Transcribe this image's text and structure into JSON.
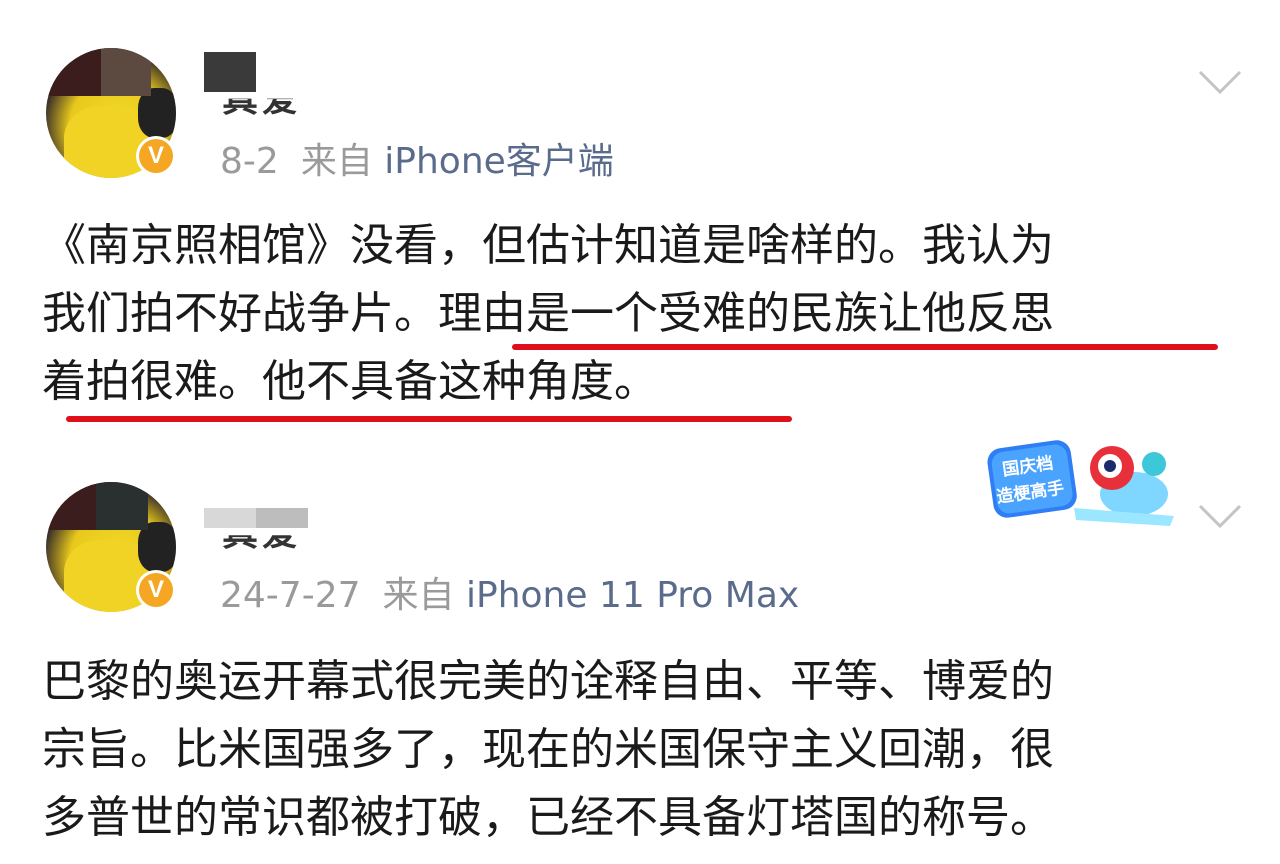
{
  "posts": [
    {
      "author_name": "真爱",
      "date": "8-2",
      "source_prefix": "来自",
      "device": "iPhone客户端",
      "verified_badge": "V",
      "lines": [
        "《南京照相馆》没看，但估计知道是啥样的。我认为",
        "我们拍不好战争片。理由是一个受难的民族让他反思",
        "着拍很难。他不具备这种角度。"
      ]
    },
    {
      "author_name": "真爱",
      "date": "24-7-27",
      "source_prefix": "来自",
      "device": "iPhone 11 Pro Max",
      "verified_badge": "V",
      "lines": [
        "巴黎的奥运开幕式很完美的诠释自由、平等、博爱的",
        "宗旨。比米国强多了，现在的米国保守主义回潮，很",
        "多普世的常识都被打破，已经不具备灯塔国的称号。"
      ]
    }
  ],
  "sticker": {
    "line1": "国庆档",
    "line2": "造梗高手"
  },
  "colors": {
    "underline": "#e0101a",
    "meta_gray": "#9a9a9a",
    "badge": "#f5a623"
  }
}
